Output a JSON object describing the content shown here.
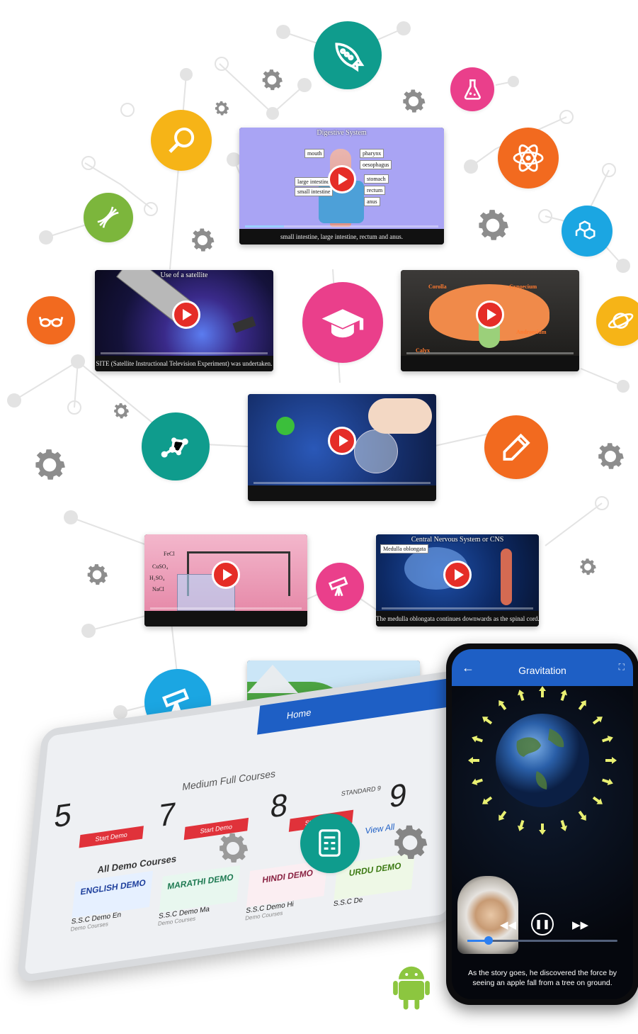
{
  "videos": [
    {
      "title": "Digestive System",
      "caption": "small intestine, large intestine, rectum and anus.",
      "labels": [
        "mouth",
        "pharynx",
        "oesophagus",
        "large intestine",
        "small intestine",
        "stomach",
        "rectum",
        "anus"
      ]
    },
    {
      "title": "Use of a satellite",
      "caption": "SITE (Satellite Instructional Television Experiment) was undertaken."
    },
    {
      "title": "",
      "caption": "",
      "labels": [
        "Corolla",
        "Gynoecium",
        "Androecium",
        "Calyx"
      ]
    },
    {
      "title": "",
      "caption": "",
      "badge": ""
    },
    {
      "title": "",
      "caption": "",
      "labels": [
        "FeCl",
        "CuSO₄",
        "H₂SO₄",
        "NaCl"
      ]
    },
    {
      "title": "Central Nervous System or CNS",
      "caption": "The medulla oblongata continues downwards as the spinal cord.",
      "badge": "Medulla oblongata"
    },
    {
      "title": "",
      "caption": ""
    }
  ],
  "phone": {
    "title": "Gravitation",
    "back_icon": "arrow-left-icon",
    "subtitle": "As the story goes, he discovered the force by seeing an apple fall from a tree on ground.",
    "progress": 0.14
  },
  "tablet": {
    "header": "Home",
    "section1": "Medium Full Courses",
    "section2": "All Demo Courses",
    "view_all": "View All",
    "demos": [
      {
        "art": "ENGLISH DEMO",
        "name": "S.S.C Demo En",
        "sub": "Demo Courses"
      },
      {
        "art": "MARATHI DEMO",
        "name": "S.S.C Demo Ma",
        "sub": "Demo Courses"
      },
      {
        "art": "HINDI DEMO",
        "name": "S.S.C Demo Hi",
        "sub": "Demo Courses"
      },
      {
        "art": "URDU DEMO",
        "name": "S.S.C De",
        "sub": ""
      }
    ],
    "numbers": [
      "5",
      "7",
      "8",
      "9"
    ],
    "start_label": "Start Demo",
    "std_label": "STANDARD 9"
  },
  "icons": {
    "colors": {
      "teal": "#0f9c8d",
      "pink": "#ea3f8b",
      "orange": "#f26a1f",
      "yellow": "#f6b417",
      "green": "#7cb63c",
      "blue": "#1ba6e2"
    }
  }
}
